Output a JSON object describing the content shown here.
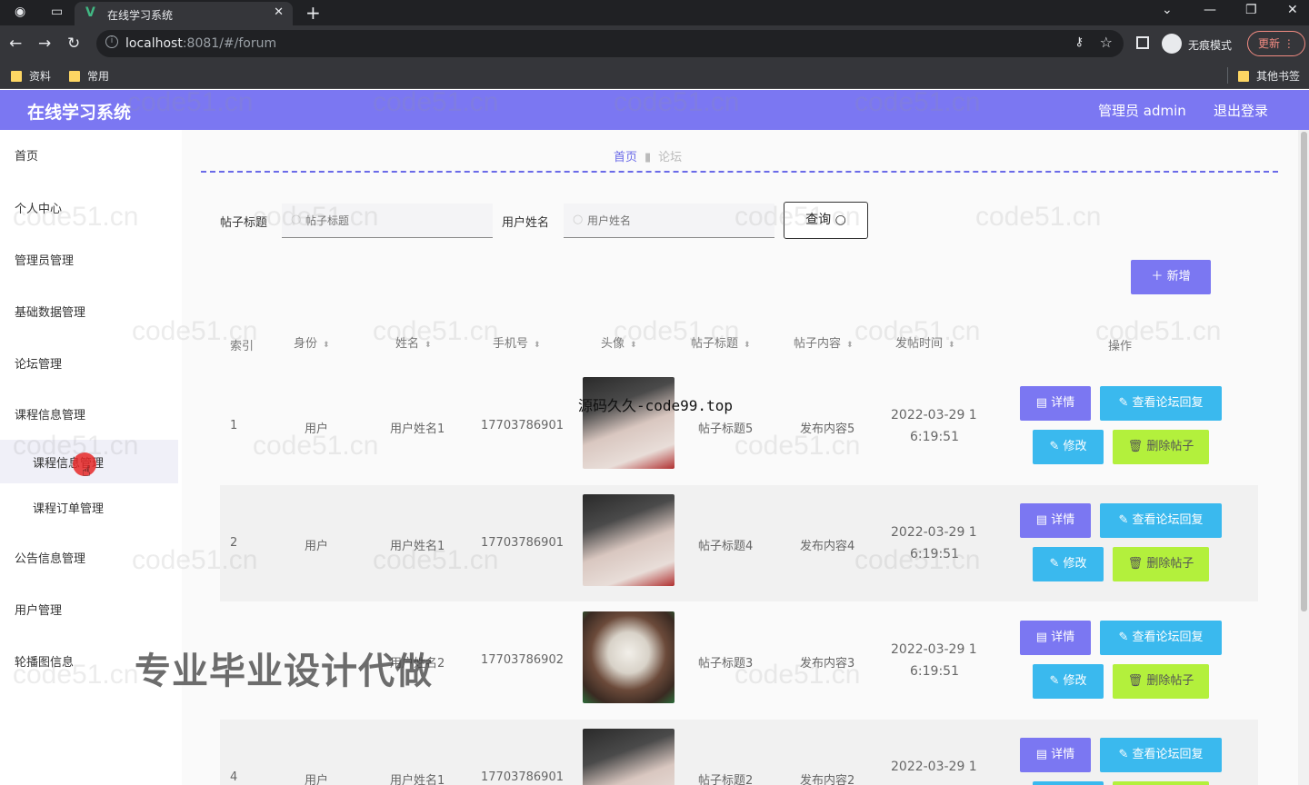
{
  "browser": {
    "tab_title": "在线学习系统",
    "tab_close": "✕",
    "new_tab": "+",
    "url_host": "localhost",
    "url_rest": ":8081/#/forum",
    "incognito_label": "无痕模式",
    "update_label": "更新",
    "bookmarks": [
      "资料",
      "常用"
    ],
    "other_bookmarks": "其他书签"
  },
  "header": {
    "title": "在线学习系统",
    "admin": "管理员 admin",
    "logout": "退出登录",
    "accent": "#7b77f2"
  },
  "sidebar": {
    "items": [
      "首页",
      "个人中心",
      "管理员管理",
      "基础数据管理",
      "论坛管理",
      "课程信息管理"
    ],
    "subitems": [
      "课程信息管理",
      "课程订单管理"
    ],
    "items_after": [
      "公告信息管理",
      "用户管理",
      "轮播图信息"
    ]
  },
  "breadcrumb": {
    "home": "首页",
    "current": "论坛"
  },
  "search": {
    "title_label": "帖子标题",
    "title_placeholder": "帖子标题",
    "user_label": "用户姓名",
    "user_placeholder": "用户姓名",
    "query_button": "查询"
  },
  "add_button": "新增",
  "table": {
    "headers": [
      "索引",
      "身份",
      "姓名",
      "手机号",
      "头像",
      "帖子标题",
      "帖子内容",
      "发帖时间",
      "操作"
    ],
    "rows": [
      {
        "index": "1",
        "role": "用户",
        "name": "用户姓名1",
        "phone": "17703786901",
        "title": "帖子标题5",
        "content": "发布内容5",
        "time_a": "2022-03-29 1",
        "time_b": "6:19:51"
      },
      {
        "index": "2",
        "role": "用户",
        "name": "用户姓名1",
        "phone": "17703786901",
        "title": "帖子标题4",
        "content": "发布内容4",
        "time_a": "2022-03-29 1",
        "time_b": "6:19:51"
      },
      {
        "index": "",
        "role": "",
        "name": "用户姓名2",
        "phone": "17703786902",
        "title": "帖子标题3",
        "content": "发布内容3",
        "time_a": "2022-03-29 1",
        "time_b": "6:19:51"
      },
      {
        "index": "4",
        "role": "用户",
        "name": "用户姓名1",
        "phone": "17703786901",
        "title": "帖子标题2",
        "content": "发布内容2",
        "time_a": "2022-03-29 1",
        "time_b": ""
      }
    ],
    "actions": {
      "detail": "详情",
      "reply": "查看论坛回复",
      "edit": "修改",
      "delete": "删除帖子"
    }
  },
  "overlays": {
    "site_mark": "源码久久-code99.top",
    "promo": "专业毕业设计代做",
    "watermark": "code51.cn"
  }
}
